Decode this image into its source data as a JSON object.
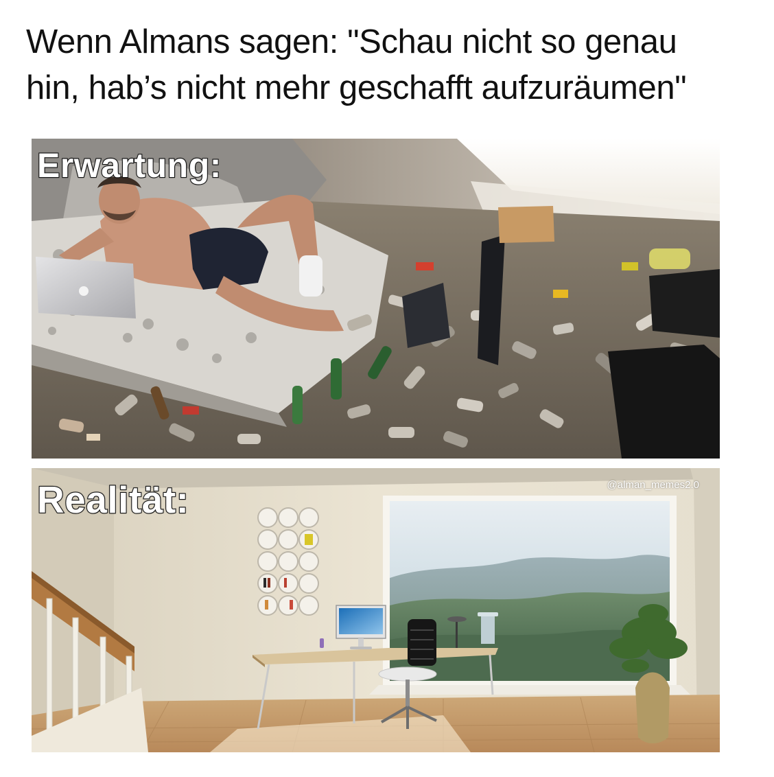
{
  "caption": {
    "line1": "Wenn Almans sagen: \"Schau nicht so genau",
    "line2": "hin, hab’s nicht mehr geschafft aufzuräumen\""
  },
  "panels": {
    "expectation": {
      "label": "Erwartung:",
      "image": "messy-room-photo"
    },
    "reality": {
      "label": "Realität:",
      "watermark": "@alman_memes2.0",
      "image": "clean-room-render"
    }
  }
}
